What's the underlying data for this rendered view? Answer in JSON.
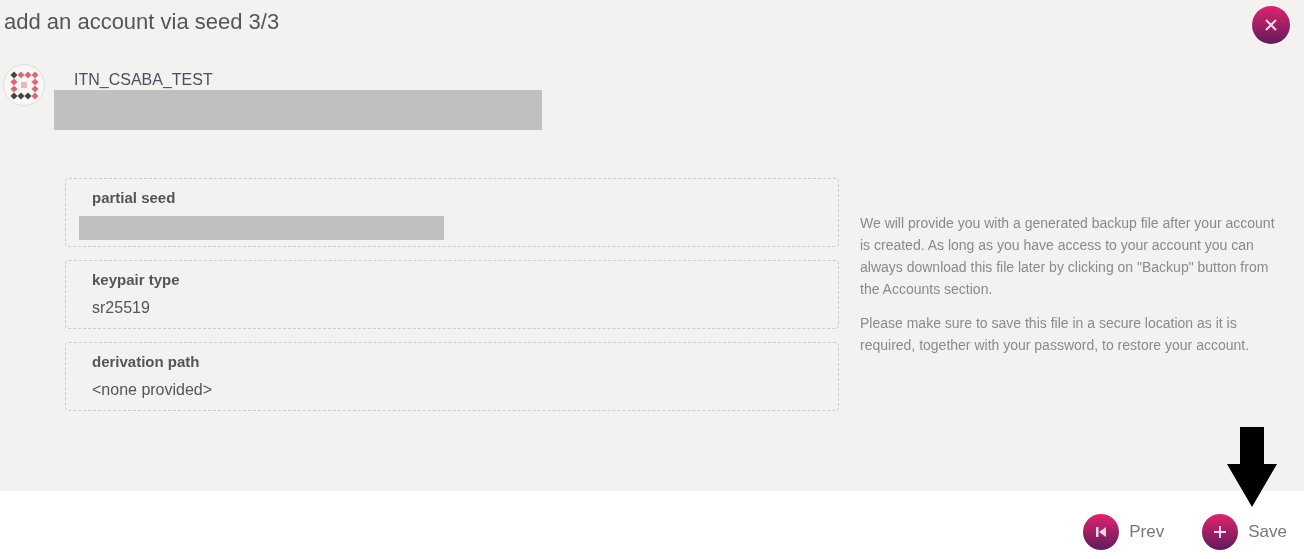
{
  "title": "add an account via seed 3/3",
  "account": {
    "name": "ITN_CSABA_TEST"
  },
  "fields": [
    {
      "label": "partial seed",
      "kind": "redacted"
    },
    {
      "label": "keypair type",
      "kind": "text",
      "value": "sr25519"
    },
    {
      "label": "derivation path",
      "kind": "text",
      "value": "<none provided>"
    }
  ],
  "info": [
    "We will provide you with a generated backup file after your account is created. As long as you have access to your account you can always download this file later by clicking on \"Backup\" button from the Accounts section.",
    "Please make sure to save this file in a secure location as it is required, together with your password, to restore your account."
  ],
  "buttons": [
    {
      "label": "Prev",
      "kind": "prev"
    },
    {
      "label": "Save",
      "kind": "save"
    }
  ]
}
